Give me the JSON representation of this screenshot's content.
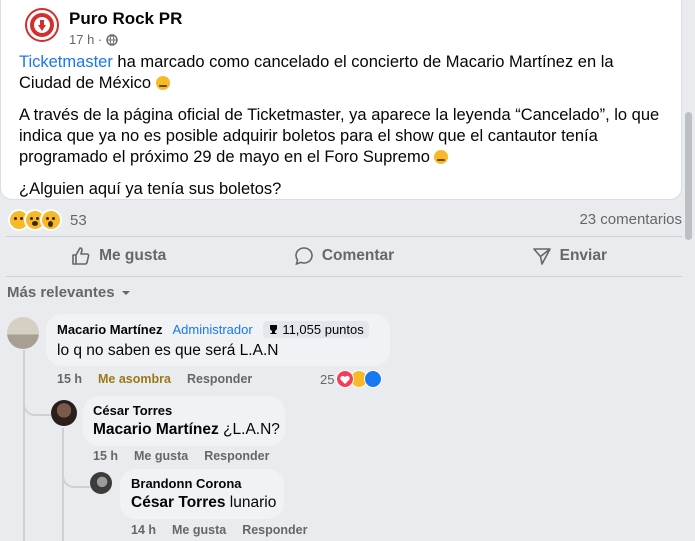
{
  "post": {
    "page_name": "Puro Rock PR",
    "time": "17 h ·",
    "line1_link": "Ticketmaster",
    "line1_rest": " ha marcado como cancelado el concierto de Macario Martínez en la Ciudad de México ",
    "para2": "A través de la página oficial de Ticketmaster, ya aparece la leyenda “Cancelado”, lo que indica que ya no es posible adquirir boletos para el show que el cantautor tenía programado el próximo 29 de mayo en el Foro Supremo ",
    "para3": "¿Alguien aquí ya tenía sus boletos?"
  },
  "stats": {
    "reaction_count": "53",
    "comments": "23 comentarios"
  },
  "actions": {
    "like": "Me gusta",
    "comment": "Comentar",
    "share": "Enviar"
  },
  "sort_label": "Más relevantes",
  "comments": [
    {
      "author": "Macario Martínez",
      "role": "Administrador",
      "points": "11,055 puntos",
      "text": "lo q no saben es que será L.A.N",
      "time": "15 h",
      "reaction_label": "Me asombra",
      "reply": "Responder",
      "reaction_count": "25"
    },
    {
      "author": "César Torres",
      "mention": "Macario Martínez",
      "text": " ¿L.A.N?",
      "time": "15 h",
      "like": "Me gusta",
      "reply": "Responder"
    },
    {
      "author": "Brandonn Corona",
      "mention": "César Torres",
      "text": " lunario",
      "time": "14 h",
      "like": "Me gusta",
      "reply": "Responder"
    }
  ],
  "colors": {
    "link": "#1877f2",
    "muted": "#65676b",
    "bubble": "#f0f2f5",
    "amber": "#9a7a14"
  }
}
